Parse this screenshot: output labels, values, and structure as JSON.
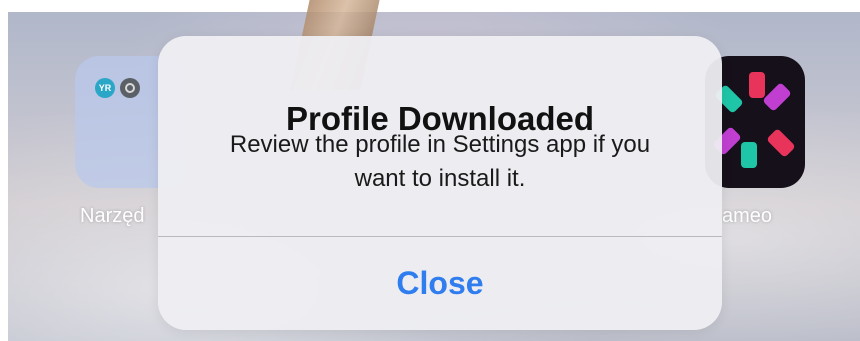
{
  "home": {
    "folder": {
      "label": "Narzęd",
      "mini_apps": [
        "YR",
        ""
      ]
    },
    "app_right": {
      "label": "ameo",
      "icon": "cameo-icon"
    }
  },
  "alert": {
    "title": "Profile Downloaded",
    "message": "Review the profile in Settings app if you want to install it.",
    "button_label": "Close",
    "button_color": "#2f7dee"
  }
}
